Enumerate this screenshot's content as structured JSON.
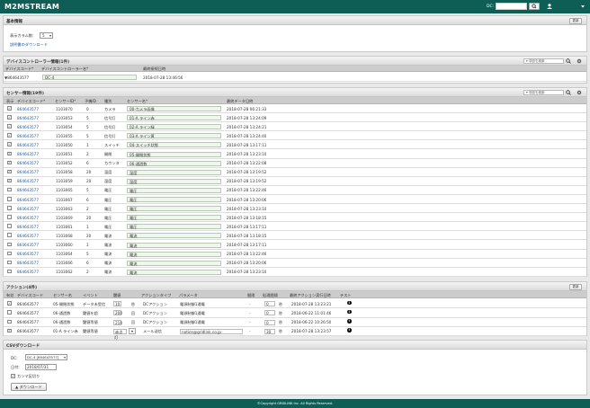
{
  "header": {
    "logo": "M2MSTREAM",
    "dc_label": "DC:",
    "dc_value": ""
  },
  "basic": {
    "title": "基本情報",
    "update_label": "更新",
    "col_label": "表示カラム数:",
    "col_value": "5",
    "manual_link": "説明書のダウンロード"
  },
  "controller": {
    "title": "デバイスコントローラー情報(1件)",
    "search_placeholder": "項目を検索",
    "headers": [
      "デバイスコード*",
      "デバイスコントローラー名*",
      "最終接続日時"
    ],
    "row": {
      "code": "864643577",
      "name": "DC-4",
      "time": "2018-07-28 13:46:56"
    }
  },
  "sensors": {
    "title": "センサー情報(19件)",
    "search_placeholder": "項目を検索",
    "headers": [
      "表示",
      "デバイスコード*",
      "センサーID*",
      "子機ID",
      "種別",
      "センサー名*",
      "最終データ日時"
    ],
    "rows": [
      {
        "show": true,
        "code": "864643577",
        "sid": "1103070",
        "child": "0",
        "type": "カメラ",
        "name": "00-カメラ画像",
        "time": "2018-07-28 06:21:33"
      },
      {
        "show": true,
        "code": "864643577",
        "sid": "1103053",
        "child": "5",
        "type": "信号灯",
        "name": "01-A ライン赤",
        "time": "2018-07-28 13:24:09"
      },
      {
        "show": true,
        "code": "864643577",
        "sid": "1103054",
        "child": "5",
        "type": "信号灯",
        "name": "02-A ライン緑",
        "time": "2018-07-28 13:24:21"
      },
      {
        "show": true,
        "code": "864643577",
        "sid": "1103055",
        "child": "5",
        "type": "信号灯",
        "name": "03-A ライン黄",
        "time": "2018-07-28 13:24:40"
      },
      {
        "show": true,
        "code": "864643577",
        "sid": "1103050",
        "child": "1",
        "type": "スイッチ",
        "name": "04-スイッチ状態",
        "time": "2018-07-28 13:17:11"
      },
      {
        "show": true,
        "code": "864643577",
        "sid": "1103051",
        "child": "2",
        "type": "開閉",
        "name": "05-開閉状態",
        "time": "2018-07-28 13:23:10"
      },
      {
        "show": true,
        "code": "864643577",
        "sid": "1103052",
        "child": "6",
        "type": "カウンタ",
        "name": "06-通過数",
        "time": "2018-07-28 13:22:08"
      },
      {
        "show": true,
        "code": "864643577",
        "sid": "1103058",
        "child": "20",
        "type": "温度",
        "name": "温度",
        "time": "2018-07-28 13:19:52"
      },
      {
        "show": true,
        "code": "864643577",
        "sid": "1103059",
        "child": "20",
        "type": "湿度",
        "name": "湿度",
        "time": "2018-07-28 13:19:52"
      },
      {
        "show": false,
        "code": "864643577",
        "sid": "1103065",
        "child": "5",
        "type": "電圧",
        "name": "電圧",
        "time": "2018-07-28 13:22:46"
      },
      {
        "show": false,
        "code": "864643577",
        "sid": "1103067",
        "child": "6",
        "type": "電圧",
        "name": "電圧",
        "time": "2018-07-28 13:20:06"
      },
      {
        "show": false,
        "code": "864643577",
        "sid": "1103063",
        "child": "2",
        "type": "電圧",
        "name": "電圧",
        "time": "2018-07-28 13:23:10"
      },
      {
        "show": false,
        "code": "864643577",
        "sid": "1103069",
        "child": "20",
        "type": "電圧",
        "name": "電圧",
        "time": "2018-07-28 13:18:15"
      },
      {
        "show": false,
        "code": "864643577",
        "sid": "1103061",
        "child": "1",
        "type": "電圧",
        "name": "電圧",
        "time": "2018-07-28 13:17:11"
      },
      {
        "show": false,
        "code": "864643577",
        "sid": "1103068",
        "child": "20",
        "type": "電流",
        "name": "電流",
        "time": "2018-07-28 13:18:15"
      },
      {
        "show": false,
        "code": "864643577",
        "sid": "1103060",
        "child": "1",
        "type": "電流",
        "name": "電流",
        "time": "2018-07-28 13:17:11"
      },
      {
        "show": false,
        "code": "864643577",
        "sid": "1103064",
        "child": "5",
        "type": "電流",
        "name": "電流",
        "time": "2018-07-28 13:22:46"
      },
      {
        "show": false,
        "code": "864643577",
        "sid": "1103066",
        "child": "6",
        "type": "電流",
        "name": "電流",
        "time": "2018-07-28 13:20:06"
      },
      {
        "show": false,
        "code": "864643577",
        "sid": "1103062",
        "child": "2",
        "type": "電流",
        "name": "電流",
        "time": "2018-07-28 13:23:10"
      }
    ]
  },
  "actions": {
    "title": "アクション(4件)",
    "update_label": "更新",
    "headers": [
      "有効",
      "デバイスコード",
      "センサー名",
      "イベント",
      "閾値",
      "",
      "アクションタイプ",
      "パラメータ",
      "",
      "間隔",
      "処理間隔",
      "",
      "最終アクション実行日時",
      "テスト"
    ],
    "rows": [
      {
        "on": true,
        "code": "864643577",
        "sensor": "05-開閉状態",
        "event": "データ未受信",
        "thr": "10",
        "unit": "秒",
        "atype": "DCアクション",
        "param": "電源制御1通電",
        "gap": "-",
        "intv": "0",
        "iu": "秒",
        "time": "2018-07-28 13:23:21"
      },
      {
        "on": false,
        "code": "864643577",
        "sensor": "06-通過数",
        "event": "閾値を超",
        "thr": "200",
        "unit": "回",
        "atype": "DCアクション",
        "param": "電源制御1通電",
        "gap": "-",
        "intv": "0",
        "iu": "秒",
        "time": "2018-06-22 11:01:46"
      },
      {
        "on": false,
        "code": "864643577",
        "sensor": "06-通過数",
        "event": "閾値等値",
        "thr": "210",
        "unit": "回",
        "atype": "DCアクション",
        "param": "電源制御1通電",
        "gap": "-",
        "intv": "0",
        "iu": "秒",
        "time": "2018-06-22 10:26:50"
      },
      {
        "on": true,
        "code": "864643577",
        "sensor": "01-A ライン赤",
        "event": "閾値等値",
        "thr": "赤点灯",
        "unit": "",
        "atype": "メール送信",
        "param": "notice@gridlink.co.jp",
        "gap": "-",
        "intv": "30",
        "iu": "秒",
        "time": "2018-07-28 13:23:57"
      }
    ]
  },
  "csv": {
    "title": "CSVダウンロード",
    "dc_label": "DC:",
    "dc_value": "DC-4 [864643577]",
    "date_label": "日付:",
    "date_value": "2018/07/31",
    "sep_label": "カンマ区切り",
    "button": "ダウンロード"
  },
  "footer": "©Copyright GRIDLINK Inc. All Rights Reserved."
}
